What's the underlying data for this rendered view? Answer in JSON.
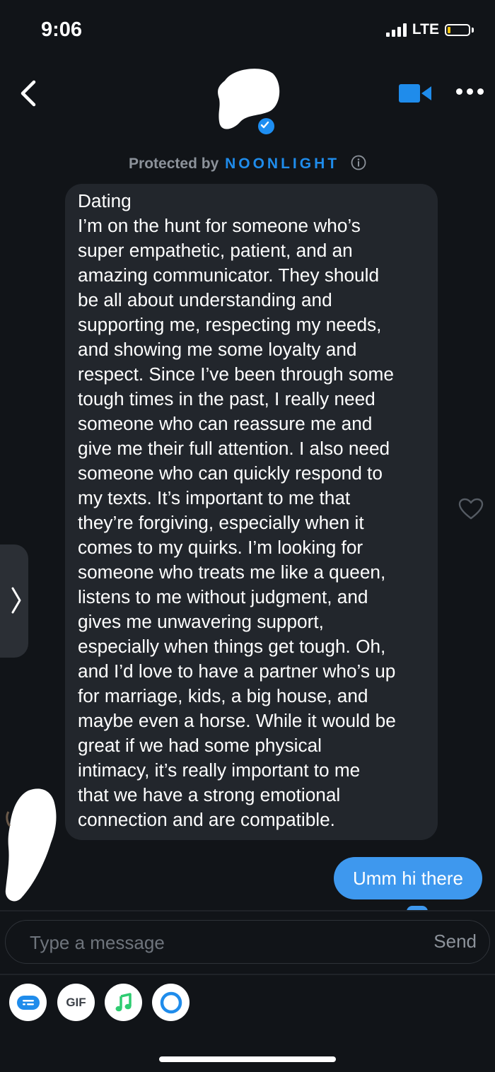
{
  "status_bar": {
    "time": "9:06",
    "network": "LTE"
  },
  "header": {
    "protected_label": "Protected by",
    "brand": "NOONLIGHT",
    "icons": [
      "back-icon",
      "video-call-icon",
      "more-icon",
      "info-icon",
      "verified-badge"
    ]
  },
  "messages": {
    "incoming": {
      "text": "Dating\nI’m on the hunt for someone who’s\nsuper empathetic, patient, and an\namazing communicator. They should\nbe all about understanding and\nsupporting me, respecting my needs,\nand showing me some loyalty and\nrespect. Since I’ve been through some\ntough times in the past, I really need\nsomeone who can reassure me and\ngive me their full attention. I also need\nsomeone who can quickly respond to\nmy texts. It’s important to me that\nthey’re forgiving, especially when it\ncomes to my quirks. I’m looking for\nsomeone who treats me like a queen,\nlistens to me without judgment, and\ngives me unwavering support,\nespecially when things get tough. Oh,\nand I’d love to have a partner who’s up\nfor marriage, kids, a big house, and\nmaybe even a horse. While it would be\ngreat if we had some physical\nintimacy, it’s really important to me\nthat we have a strong emotional\nconnection and are compatible."
    },
    "outgoing": {
      "text": "Umm hi there"
    }
  },
  "composer": {
    "placeholder": "Type a message",
    "send_label": "Send"
  },
  "attachments": {
    "gif_label": "GIF",
    "icons": [
      "sticker-icon",
      "gif-icon",
      "music-icon",
      "ring-icon"
    ]
  },
  "colors": {
    "background": "#111418",
    "incoming_bubble": "#22262c",
    "outgoing_bubble": "#3e98ee",
    "brand_blue": "#1f8ceb",
    "battery": "#f1c40f"
  }
}
